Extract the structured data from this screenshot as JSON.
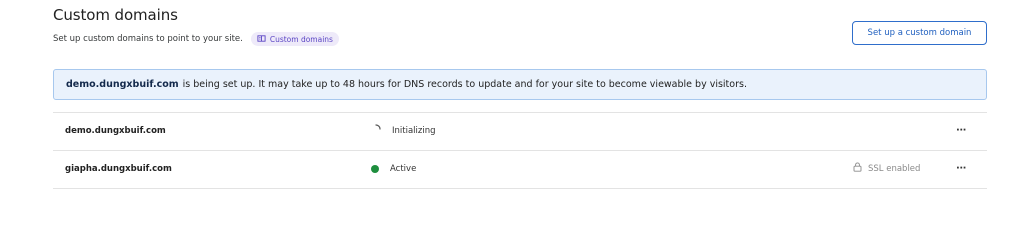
{
  "header": {
    "title": "Custom domains",
    "description": "Set up custom domains to point to your site.",
    "docs_pill_label": "Custom domains"
  },
  "actions": {
    "setup_button_label": "Set up a custom domain"
  },
  "banner": {
    "domain": "demo.dungxbuif.com",
    "message": "is being set up. It may take up to 48 hours for DNS records to update and for your site to become viewable by visitors."
  },
  "domains": [
    {
      "name": "demo.dungxbuif.com",
      "status": "Initializing",
      "ssl": "",
      "status_icon": "spinner-icon"
    },
    {
      "name": "giapha.dungxbuif.com",
      "status": "Active",
      "ssl": "SSL enabled",
      "status_icon": "active-dot-icon",
      "status_color": "#1e8e3e"
    }
  ],
  "more_menu_label": "···",
  "colors": {
    "accent": "#2f6ecb",
    "banner_bg": "#eaf2fc",
    "banner_border": "#a7c8ee",
    "pill_bg": "#eeeaf9",
    "pill_text": "#5a44c4",
    "active": "#1e8e3e"
  }
}
